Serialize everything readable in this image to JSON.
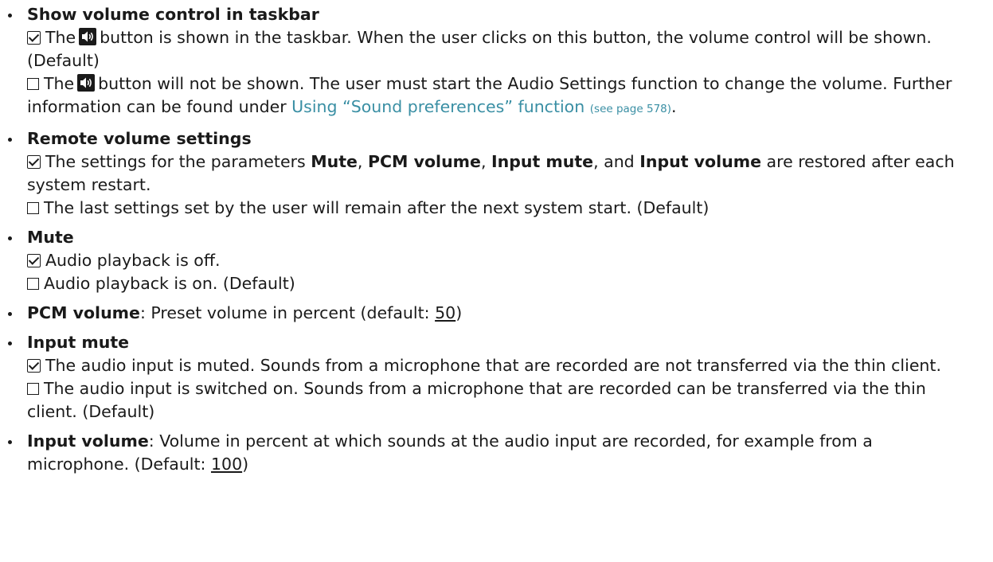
{
  "items": [
    {
      "title": "Show volume control in taskbar",
      "on_a": "The",
      "on_b": "button is shown in the taskbar. When the user clicks on this button, the volume control will be shown. (Default)",
      "off_a": "The",
      "off_b": "button will not be shown. The user must start the Audio Settings function to change the volume. Further information can be found under",
      "link_text": "Using “Sound preferences” function",
      "link_ref": "(see page 578)",
      "end": "."
    },
    {
      "title": "Remote volume settings",
      "on_1": "The settings for the parameters",
      "on_mute": "Mute",
      "on_sep1": ",",
      "on_pcm": "PCM volume",
      "on_sep2": ",",
      "on_input_mute": "Input mute",
      "on_and": ", and",
      "on_input_volume": "Input volume",
      "on_end": "are restored after each system restart.",
      "off": "The last settings set by the user will remain after the next system start. (Default)"
    },
    {
      "title": "Mute",
      "on": "Audio playback is off.",
      "off": "Audio playback is on. (Default)"
    },
    {
      "title": "PCM volume",
      "desc": ": Preset volume in percent (default:",
      "default_value": "50",
      "close": ")"
    },
    {
      "title": "Input mute",
      "on": "The audio input is muted. Sounds from a microphone that are recorded are not transferred via the thin client.",
      "off": "The audio input is switched on. Sounds from a microphone that are recorded can be transferred via the thin client. (Default)"
    },
    {
      "title": "Input volume",
      "desc": ": Volume in percent at which sounds at the audio input are recorded, for example from a microphone. (Default:",
      "default_value": "100",
      "close": ")"
    }
  ]
}
